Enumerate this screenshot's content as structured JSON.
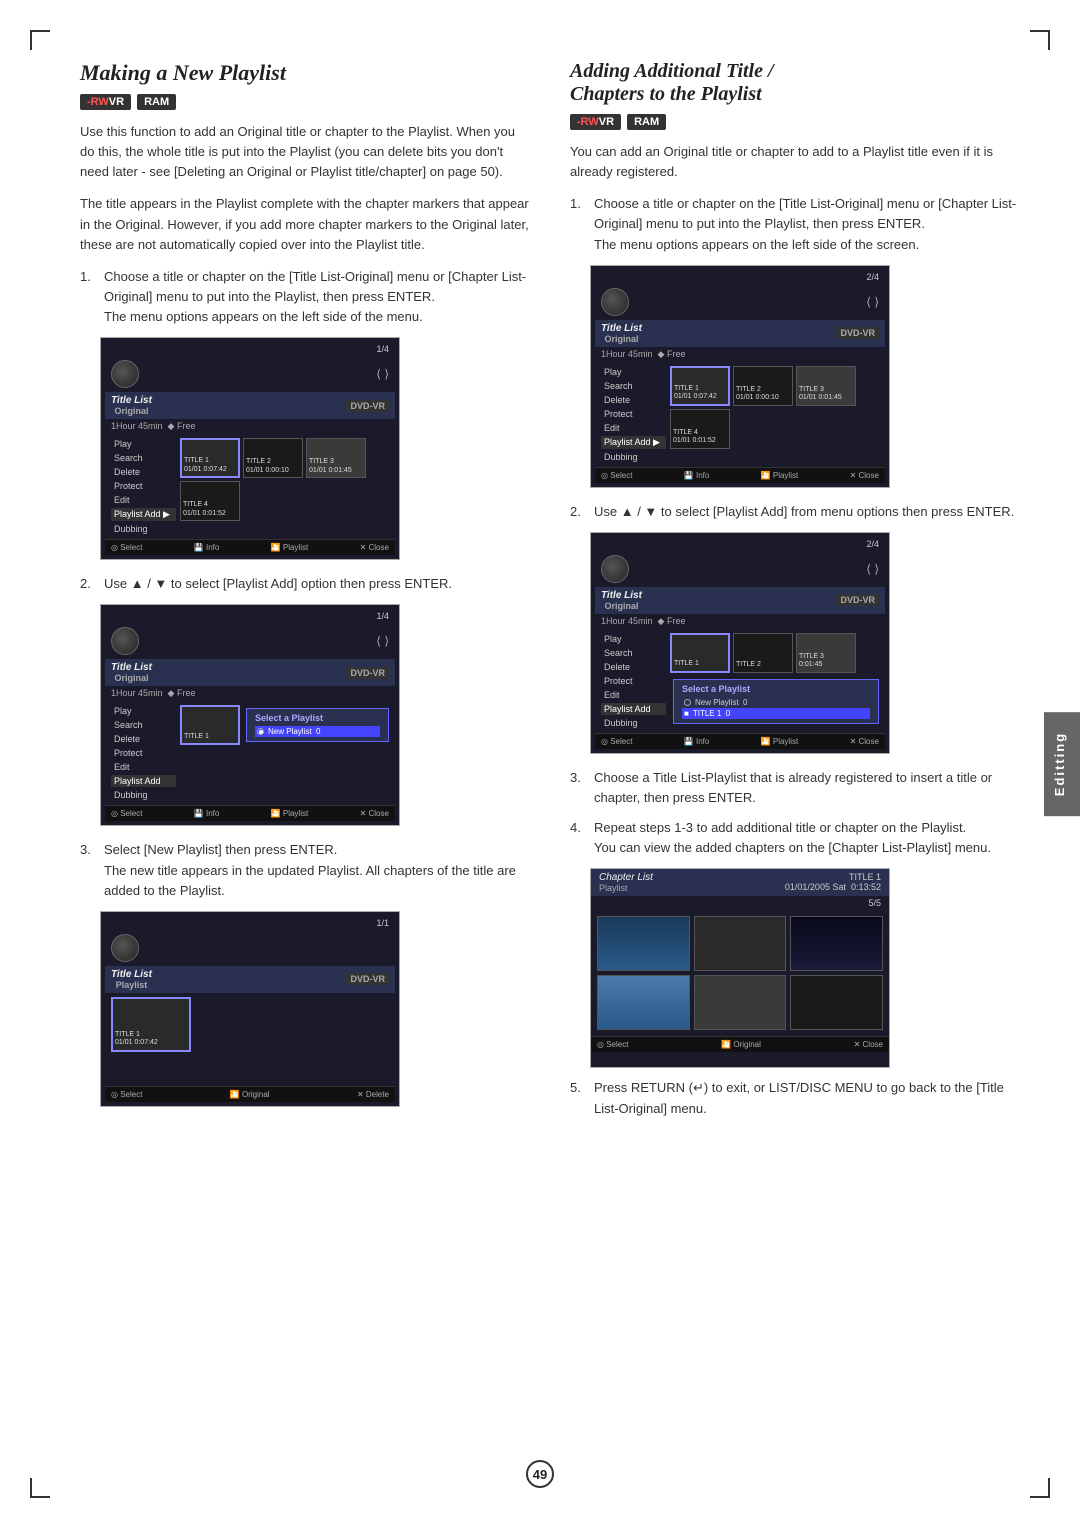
{
  "page": {
    "number": "49",
    "side_tab": "Editting"
  },
  "left_section": {
    "title": "Making a New Playlist",
    "badges": [
      "-RWvr",
      "RAM"
    ],
    "intro_paragraphs": [
      "Use this function to add an Original title or chapter to the Playlist. When you do this, the whole title is put into the Playlist (you can delete bits you don't need later - see [Deleting an Original or Playlist title/chapter] on page 50).",
      "The title appears in the Playlist complete with the chapter markers that appear in the Original. However, if you add more chapter markers to the Original later, these are not automatically copied over into the Playlist title."
    ],
    "steps": [
      {
        "num": "1.",
        "text": "Choose a title or chapter on the [Title List-Original] menu or [Chapter List-Original] menu to put into the Playlist, then press ENTER.\nThe menu options appears on the left side of the menu."
      },
      {
        "num": "2.",
        "text": "Use ▲ / ▼ to select [Playlist Add] option then press ENTER."
      },
      {
        "num": "3.",
        "text": "Select [New Playlist] then press ENTER.\nThe new title appears in the updated Playlist. All chapters of the title are added to the Playlist."
      }
    ],
    "screenshots": {
      "s1": {
        "header_title": "Title List",
        "header_sub": "Original",
        "page_num": "1/4",
        "badge": "DVD-VR",
        "info": "1Hour 45min  🔷 Free",
        "menu_items": [
          "Play",
          "Search",
          "Delete",
          "Protect",
          "Edit",
          "Playlist Add ▶",
          "Dubbing"
        ],
        "highlight_menu": "Playlist Add ▶",
        "titles": [
          {
            "label": "TITLE 1",
            "time": "01/01  0:07:42"
          },
          {
            "label": "TITLE 2",
            "time": "01/01  0:00:10"
          },
          {
            "label": "TITLE 3",
            "time": "01/01  0:01:45"
          },
          {
            "label": "TITLE 4",
            "time": "01/01  0:01:52"
          }
        ],
        "bottom_bar": "⊙ Select  📀 Info  🎬 Playlist  ✕ Close"
      },
      "s2": {
        "header_title": "Title List",
        "header_sub": "Original",
        "page_num": "1/4",
        "badge": "DVD-VR",
        "info": "1Hour 45min  🔷 Free",
        "menu_items": [
          "Play",
          "Search",
          "Delete",
          "Protect",
          "Edit",
          "Playlist Add",
          "Dubbing"
        ],
        "popup_title": "Select a Playlist",
        "popup_items": [
          "🔘 New Playlist  0"
        ],
        "bottom_bar": "⊙ Select  📀 Info  🎬 Playlist  ✕ Close"
      },
      "s3": {
        "header_title": "Title List",
        "header_sub": "Playlist",
        "page_num": "1/1",
        "badge": "DVD-VR",
        "title": "TITLE 1",
        "time": "01/01  0:07:42",
        "bottom_bar": "⊙ Select  📀 Original  ✕ Delete"
      }
    }
  },
  "right_section": {
    "title": "Adding Additional Title / Chapters to the Playlist",
    "badges": [
      "-RWvr",
      "RAM"
    ],
    "intro": "You can add an Original title or chapter to add to a Playlist title even if it is already registered.",
    "steps": [
      {
        "num": "1.",
        "text": "Choose a title or chapter on the [Title List-Original] menu or [Chapter List-Original] menu to put into the Playlist, then press ENTER.\nThe menu options appears on the left side of the screen."
      },
      {
        "num": "2.",
        "text": "Use ▲ / ▼ to select [Playlist Add] from menu options then press ENTER."
      },
      {
        "num": "3.",
        "text": "Choose a Title List-Playlist that is already registered to insert a title or chapter, then press ENTER."
      },
      {
        "num": "4.",
        "text": "Repeat steps 1-3 to add additional title or chapter on the Playlist.\nYou can view the added chapters on the [Chapter List-Playlist] menu."
      },
      {
        "num": "5.",
        "text": "Press RETURN (⤶) to exit, or LIST/DISC MENU to go back to the [Title List-Original] menu."
      }
    ],
    "screenshots": {
      "s1": {
        "header_title": "Title List",
        "header_sub": "Original",
        "page_num": "2/4",
        "badge": "DVD-VR",
        "info": "1Hour 45min  🔷 Free",
        "menu_items": [
          "Play",
          "Search",
          "Delete",
          "Protect",
          "Edit",
          "Playlist Add ▶",
          "Dubbing"
        ],
        "highlight_menu": "Playlist Add ▶",
        "titles": [
          {
            "label": "TITLE 1",
            "time": "01/01  0:07:42"
          },
          {
            "label": "TITLE 2",
            "time": "01/01  0:00:10"
          },
          {
            "label": "TITLE 3",
            "time": "01/01  0:01:45"
          },
          {
            "label": "TITLE 4",
            "time": "01/01  0:01:52"
          }
        ],
        "bottom_bar": "⊙ Select  📀 Info  🎬 Playlist  ✕ Close"
      },
      "s2": {
        "header_title": "Title List",
        "header_sub": "Original",
        "page_num": "2/4",
        "badge": "DVD-VR",
        "info": "1Hour 45min  🔷 Free",
        "menu_items": [
          "Play",
          "Search",
          "Delete",
          "Protect",
          "Edit",
          "Playlist Add",
          "Dubbing"
        ],
        "popup_title": "Select a Playlist",
        "popup_items": [
          "🔘 New Playlist  0",
          "■ TITLE 1  0"
        ],
        "bottom_bar": "⊙ Select  📀 Info  🎬 Playlist  ✕ Close"
      },
      "s3": {
        "header_title": "Chapter List",
        "header_sub": "Playlist",
        "page_num": "5/5",
        "title": "TITLE 1",
        "date": "01/01/2005 Sat  0:13:52",
        "bottom_bar": "⊙ Select  🎬 Original  ✕ Close"
      }
    }
  }
}
